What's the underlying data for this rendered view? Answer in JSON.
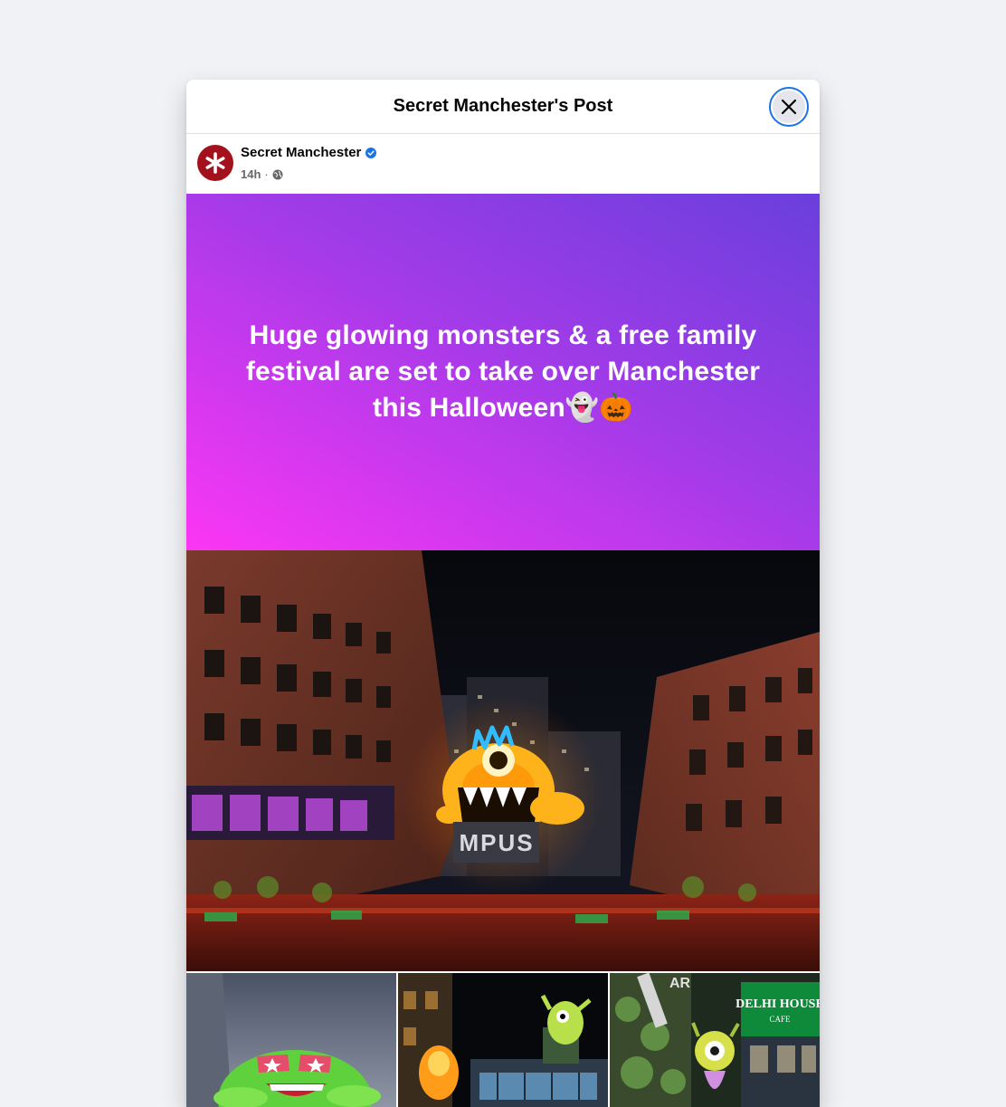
{
  "dialog": {
    "title": "Secret Manchester's Post",
    "close_icon": "close-icon"
  },
  "post": {
    "author": "Secret Manchester",
    "verified_icon": "verified-badge-icon",
    "time": "14h",
    "separator": "·",
    "privacy_icon": "globe-icon",
    "banner_text": "Huge glowing monsters & a free family festival are set to take over Manchester this Halloween👻🎃",
    "banner_colors": [
      "#fb36f4",
      "#a13be8",
      "#6a3fdc"
    ],
    "images": [
      {
        "name": "main-photo",
        "description_icon": "building-night-photo"
      },
      {
        "name": "thumb-1",
        "description_icon": "frog-inflatable-photo"
      },
      {
        "name": "thumb-2",
        "description_icon": "monster-street-photo"
      },
      {
        "name": "thumb-3",
        "description_icon": "cyclops-cafe-photo"
      }
    ]
  }
}
